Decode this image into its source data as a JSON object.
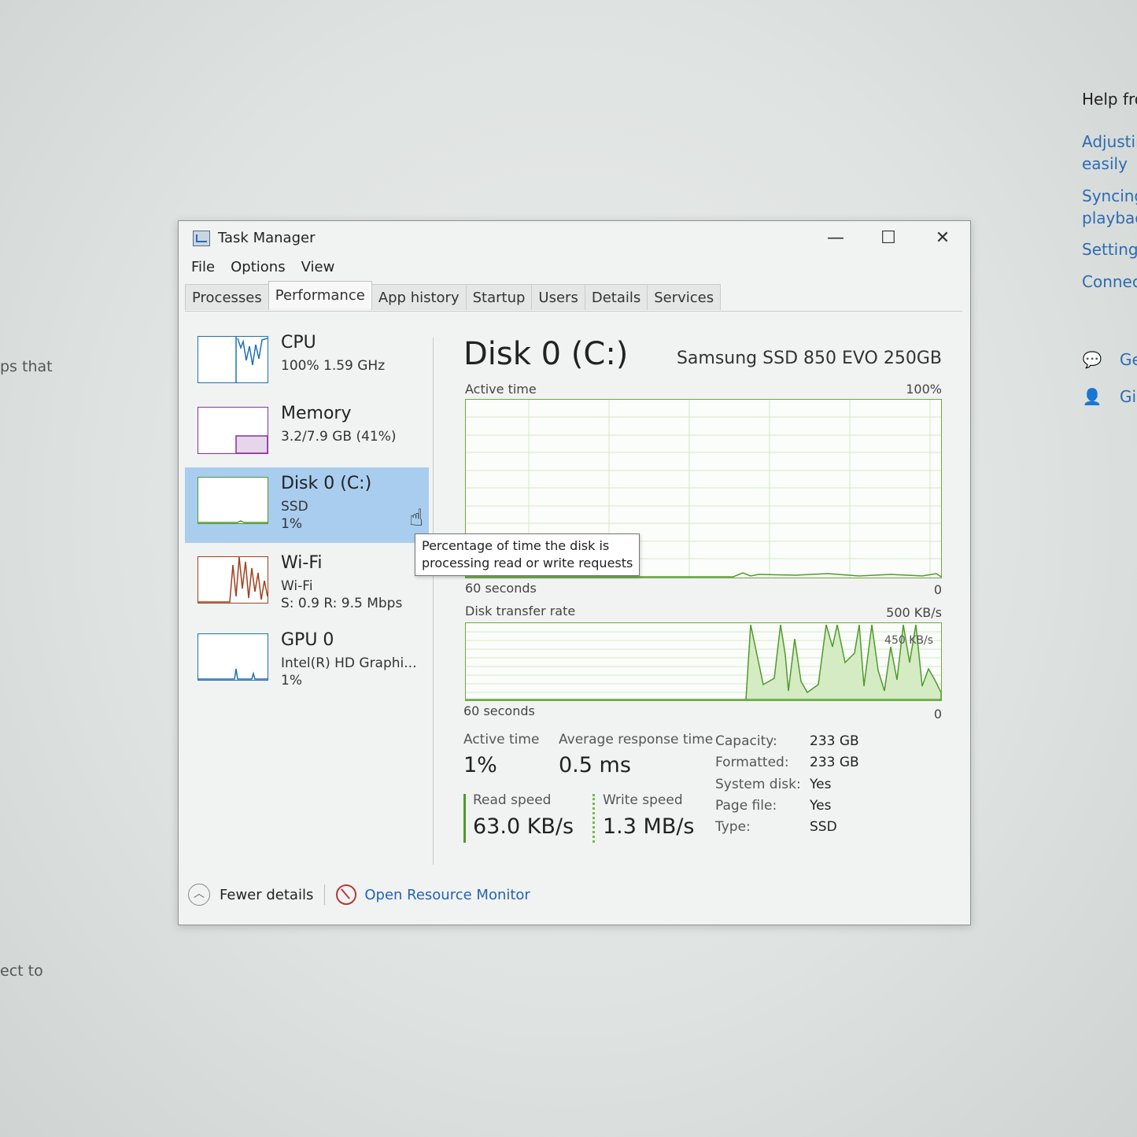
{
  "background": {
    "left_text_1": "ps that",
    "left_text_2": "ect to",
    "help": {
      "title": "Help fro",
      "links": [
        "Adjustin",
        "easily",
        "Syncing",
        "playbac",
        "Setting",
        "Connec"
      ],
      "actions": [
        {
          "icon": "chat-help-icon",
          "label": "Ge"
        },
        {
          "icon": "feedback-person-icon",
          "label": "Gi"
        }
      ]
    }
  },
  "window": {
    "title": "Task Manager",
    "controls": {
      "minimize": "—",
      "maximize": "☐",
      "close": "✕"
    },
    "menu": [
      "File",
      "Options",
      "View"
    ],
    "tabs": [
      "Processes",
      "Performance",
      "App history",
      "Startup",
      "Users",
      "Details",
      "Services"
    ],
    "active_tab": "Performance"
  },
  "sidebar": [
    {
      "name": "CPU",
      "line1": "100%  1.59 GHz",
      "line2": "",
      "color": "#1f6fb5"
    },
    {
      "name": "Memory",
      "line1": "3.2/7.9 GB (41%)",
      "line2": "",
      "color": "#8b2fa0"
    },
    {
      "name": "Disk 0 (C:)",
      "line1": "SSD",
      "line2": "1%",
      "color": "#4f9a2c",
      "selected": true
    },
    {
      "name": "Wi-Fi",
      "line1": "Wi-Fi",
      "line2": "S: 0.9  R: 9.5 Mbps",
      "color": "#a2401e"
    },
    {
      "name": "GPU 0",
      "line1": "Intel(R) HD Graphi...",
      "line2": "1%",
      "color": "#1f6fb5"
    }
  ],
  "main": {
    "title": "Disk 0 (C:)",
    "model": "Samsung SSD 850 EVO 250GB",
    "active_graph": {
      "label": "Active time",
      "max": "100%",
      "time": "60 seconds",
      "min": "0"
    },
    "transfer_graph": {
      "label": "Disk transfer rate",
      "max": "500 KB/s",
      "mid": "450 KB/s",
      "time": "60 seconds",
      "min": "0"
    },
    "stats": {
      "active_time_label": "Active time",
      "active_time_value": "1%",
      "avg_resp_label": "Average response time",
      "avg_resp_value": "0.5 ms",
      "read_label": "Read speed",
      "read_value": "63.0 KB/s",
      "write_label": "Write speed",
      "write_value": "1.3 MB/s"
    },
    "properties": [
      {
        "key": "Capacity:",
        "value": "233 GB"
      },
      {
        "key": "Formatted:",
        "value": "233 GB"
      },
      {
        "key": "System disk:",
        "value": "Yes"
      },
      {
        "key": "Page file:",
        "value": "Yes"
      },
      {
        "key": "Type:",
        "value": "SSD"
      }
    ]
  },
  "tooltip": {
    "line1": "Percentage of time the disk is",
    "line2": "processing read or write requests"
  },
  "footer": {
    "fewer_details": "Fewer details",
    "open_resource_monitor": "Open Resource Monitor"
  }
}
